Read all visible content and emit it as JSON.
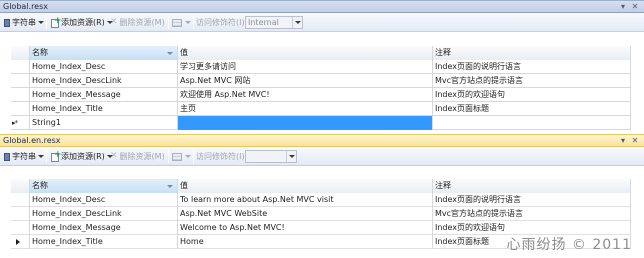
{
  "editors": [
    {
      "file_tab": "Global.resx",
      "toolbar": {
        "strings_label": "字符串",
        "add_resource_label": "添加资源(R)",
        "remove_resource_label": "删除资源(M)",
        "access_modifier_label": "访问修饰符(I):",
        "access_modifier_value": "Internal"
      },
      "columns": {
        "name": "名称",
        "value": "值",
        "comment": "注释"
      },
      "rows": [
        {
          "name": "Home_Index_Desc",
          "value": "学习更多请访问",
          "comment": "Index页面的说明行语言"
        },
        {
          "name": "Home_Index_DescLink",
          "value": "Asp.Net MVC 网站",
          "comment": "Mvc官方站点的提示语言"
        },
        {
          "name": "Home_Index_Message",
          "value": "欢迎使用 Asp.Net MVC!",
          "comment": "Index页的欢迎语句"
        },
        {
          "name": "Home_Index_Title",
          "value": "主页",
          "comment": "Index页面标题"
        },
        {
          "name": "String1",
          "value": "",
          "comment": ""
        }
      ],
      "new_row_marker": "▸*"
    },
    {
      "file_tab": "Global.en.resx",
      "toolbar": {
        "strings_label": "字符串",
        "add_resource_label": "添加资源(R)",
        "remove_resource_label": "删除资源(M)",
        "access_modifier_label": "访问修饰符(I):",
        "access_modifier_value": ""
      },
      "columns": {
        "name": "名称",
        "value": "值",
        "comment": "注释"
      },
      "rows": [
        {
          "name": "Home_Index_Desc",
          "value": "To learn more about Asp.Net MVC visit",
          "comment": "Index页面的说明行语言"
        },
        {
          "name": "Home_Index_DescLink",
          "value": "Asp.Net MVC WebSite",
          "comment": "Mvc官方站点的提示语言"
        },
        {
          "name": "Home_Index_Message",
          "value": "Welcome to Asp.Net MVC!",
          "comment": "Index页的欢迎语句"
        },
        {
          "name": "Home_Index_Title",
          "value": "Home",
          "comment": "Index页面标题"
        }
      ]
    }
  ],
  "watermark": "心雨纷扬 © 2011"
}
